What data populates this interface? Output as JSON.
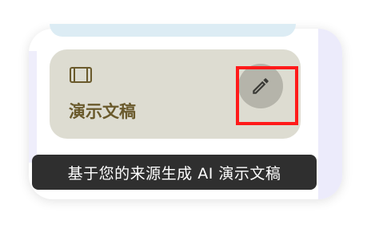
{
  "card": {
    "label": "演示文稿",
    "icon": "slides-icon",
    "background": "#dddcd1",
    "label_color": "#6a5a2c"
  },
  "edit_button": {
    "icon": "pencil-icon"
  },
  "tooltip": {
    "text": "基于您的来源生成 AI 演示文稿"
  },
  "colors": {
    "highlight": "#ff1a1a",
    "tooltip_bg": "#2f2f2f",
    "accent_strip": "#ecebfb"
  }
}
